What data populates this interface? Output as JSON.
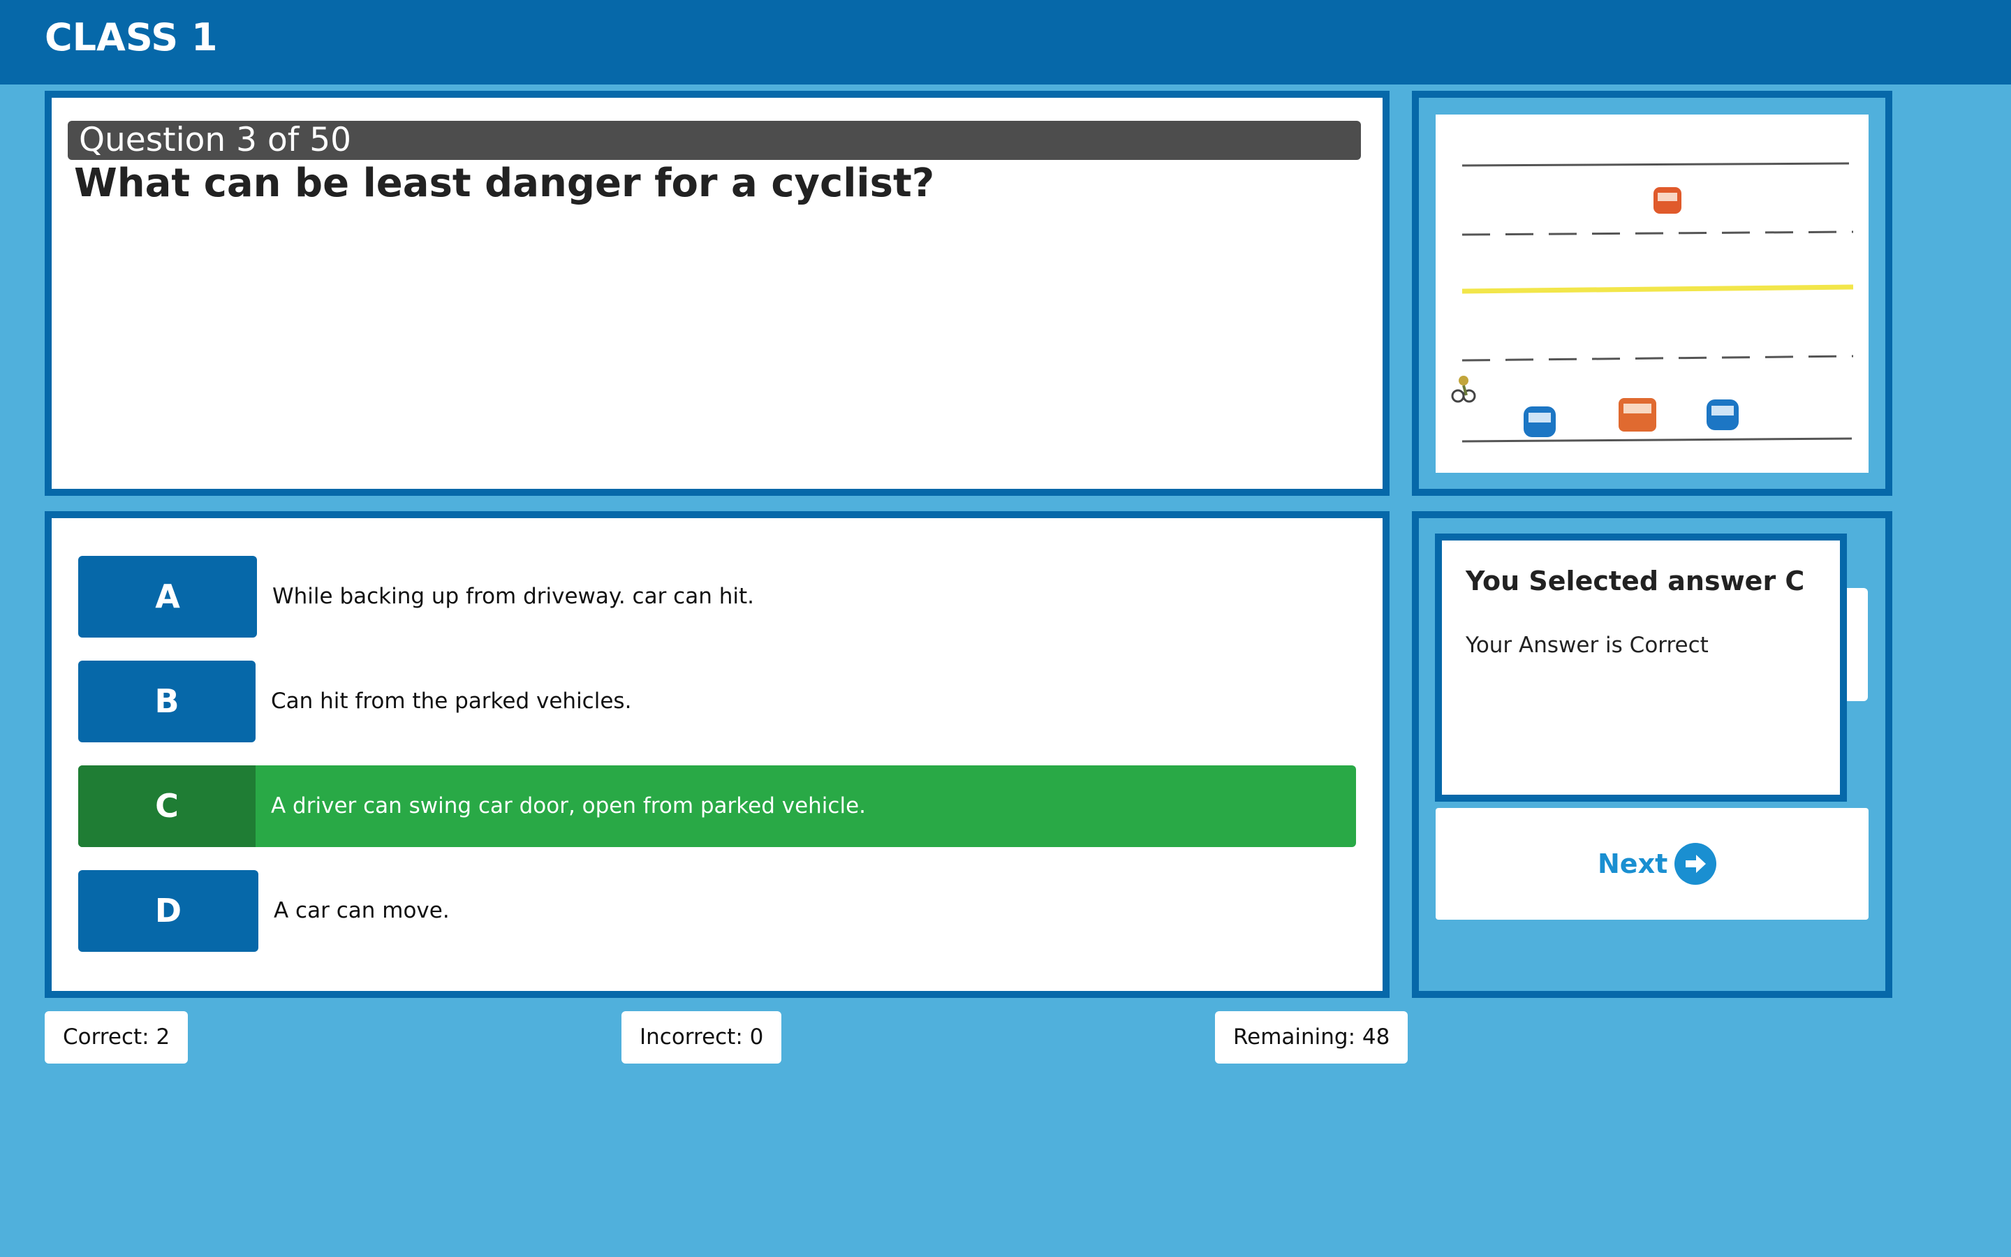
{
  "header": {
    "title": "CLASS 1"
  },
  "question": {
    "progress": "Question 3 of 50",
    "text": "What can be least danger for a cyclist?"
  },
  "illustration": {
    "description_icon": "road-scene-image"
  },
  "answers": [
    {
      "letter": "A",
      "text": "While backing up from driveway. car can hit.",
      "state": "default"
    },
    {
      "letter": "B",
      "text": "Can hit from the parked vehicles.",
      "state": "default"
    },
    {
      "letter": "C",
      "text": "A driver can swing car door, open from parked vehicle.",
      "state": "correct"
    },
    {
      "letter": "D",
      "text": "A car can move.",
      "state": "default"
    }
  ],
  "result": {
    "title": "You Selected answer C",
    "message": "Your Answer is Correct"
  },
  "next": {
    "label": "Next",
    "icon": "arrow-right-circle-icon"
  },
  "stats": {
    "correct": "Correct: 2",
    "incorrect": "Incorrect: 0",
    "remaining": "Remaining: 48"
  },
  "colors": {
    "background": "#50b0dc",
    "header": "#0668a9",
    "correct": "#29a946",
    "correct_letter": "#1f7d34",
    "next": "#1a8fd1"
  }
}
